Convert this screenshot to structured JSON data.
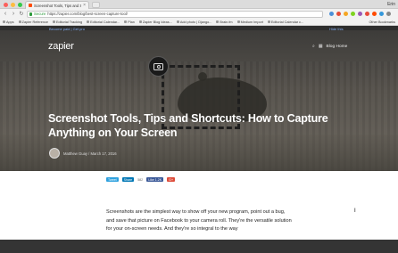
{
  "browser": {
    "tab_title": "Screenshot Tools, Tips and Sh",
    "tab_close": "×",
    "user_name": "Erin",
    "nav": {
      "back": "‹",
      "forward": "›",
      "reload": "↻"
    },
    "secure_label": "Secure",
    "url": "https://zapier.com/blog/best-screen-capture-tool/",
    "bookmarks": [
      "Apps",
      "Zapier Reference",
      "Editorial Tracking",
      "Editorial Calendar...",
      "Plan",
      "Zapier Blog Ideas...",
      "Add photo | Django...",
      "Brain.fm",
      "Medium Import",
      "Editorial Calendar c...",
      "Other Bookmarks"
    ]
  },
  "page": {
    "topbar_left": "Become paid | Get pro",
    "topbar_right": "Hide this",
    "logo": "zapier",
    "nav_home": "Blog Home",
    "title": "Screenshot Tools, Tips and Shortcuts: How to Capture Anything on Your Screen",
    "byline": "Matthew Guay / March 17, 2016",
    "share": {
      "tweet": "Tweet",
      "share": "Share",
      "share_count": "582",
      "like": "Like 1.2K",
      "gplus": "G+"
    },
    "body": "Screenshots are the simplest way to show off your new program, point out a bug, and save that picture on Facebook to your camera roll. They're the versatile solution for your on-screen needs. And they're so integral to the way"
  },
  "colors": {
    "accent": "#ff4a00",
    "twitter": "#2ea1de",
    "linkedin": "#0077b5",
    "facebook": "#3b5998",
    "gplus": "#dd4b39"
  }
}
